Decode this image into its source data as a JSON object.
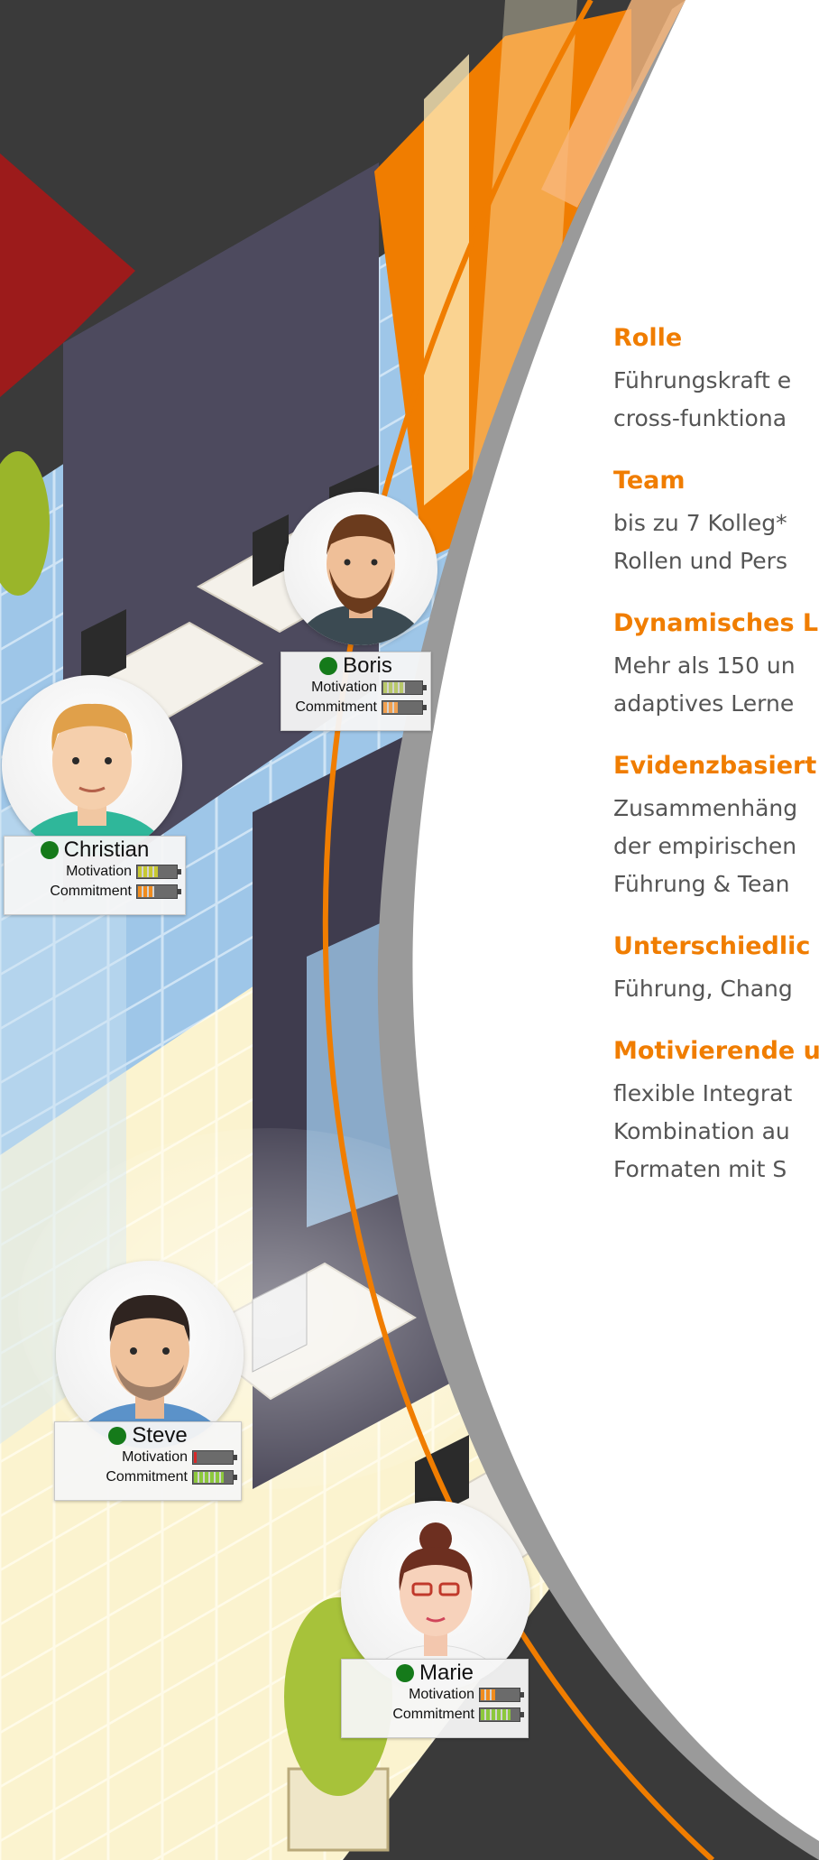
{
  "colors": {
    "accent_orange": "#f07d00",
    "dark_bg": "#3a3a3a",
    "text_gray": "#555555",
    "status_green": "#157a1a"
  },
  "characters": [
    {
      "name": "Boris",
      "motivation_label": "Motivation",
      "commitment_label": "Commitment",
      "motivation_level": 0.6,
      "commitment_level": 0.4,
      "motivation_color": "#b8c86a",
      "commitment_color": "#f0a050"
    },
    {
      "name": "Christian",
      "motivation_label": "Motivation",
      "commitment_label": "Commitment",
      "motivation_level": 0.55,
      "commitment_level": 0.45,
      "motivation_color": "#c8c832",
      "commitment_color": "#f08c1e"
    },
    {
      "name": "Steve",
      "motivation_label": "Motivation",
      "commitment_label": "Commitment",
      "motivation_level": 0.12,
      "commitment_level": 0.8,
      "motivation_color": "#d82828",
      "commitment_color": "#8cc83c"
    },
    {
      "name": "Marie",
      "motivation_label": "Motivation",
      "commitment_label": "Commitment",
      "motivation_level": 0.4,
      "commitment_level": 0.8,
      "motivation_color": "#f08c1e",
      "commitment_color": "#8cc83c"
    }
  ],
  "features": [
    {
      "heading": "Rolle",
      "lines": [
        "Führungskraft e",
        "cross-funktiona"
      ]
    },
    {
      "heading": "Team",
      "lines": [
        "bis zu 7 Kolleg*",
        "Rollen und Pers"
      ]
    },
    {
      "heading": "Dynamisches L",
      "lines": [
        "Mehr als 150 un",
        "adaptives Lerne"
      ]
    },
    {
      "heading": "Evidenzbasiert",
      "lines": [
        "Zusammenhäng",
        "der empirischen",
        "Führung & Tean"
      ]
    },
    {
      "heading": "Unterschiedlic",
      "lines": [
        "Führung, Chang"
      ]
    },
    {
      "heading": "Motivierende u",
      "lines": [
        "flexible Integrat",
        "Kombination au",
        "Formaten mit S"
      ]
    }
  ]
}
